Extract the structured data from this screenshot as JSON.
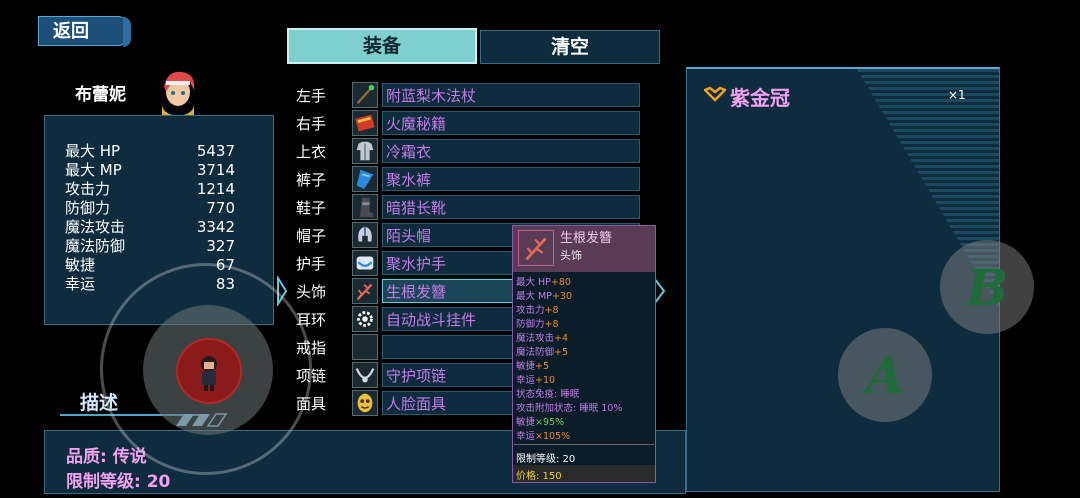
{
  "back_label": "返回",
  "character": {
    "name": "布蕾妮",
    "stats": [
      {
        "label": "最大 HP",
        "value": "5437"
      },
      {
        "label": "最大 MP",
        "value": "3714"
      },
      {
        "label": "攻击力",
        "value": "1214"
      },
      {
        "label": "防御力",
        "value": "770"
      },
      {
        "label": "魔法攻击",
        "value": "3342"
      },
      {
        "label": "魔法防御",
        "value": "327"
      },
      {
        "label": "敏捷",
        "value": "67"
      },
      {
        "label": "幸运",
        "value": "83"
      }
    ]
  },
  "tabs": {
    "equip": "装备",
    "clear": "清空"
  },
  "slots": [
    {
      "slot": "左手",
      "item": "附蓝梨木法杖",
      "icon": "staff-icon"
    },
    {
      "slot": "右手",
      "item": "火魔秘籍",
      "icon": "book-icon"
    },
    {
      "slot": "上衣",
      "item": "冷霜衣",
      "icon": "armor-icon"
    },
    {
      "slot": "裤子",
      "item": "聚水裤",
      "icon": "pants-icon"
    },
    {
      "slot": "鞋子",
      "item": "暗猎长靴",
      "icon": "boots-icon"
    },
    {
      "slot": "帽子",
      "item": "陌头帽",
      "icon": "helmet-icon"
    },
    {
      "slot": "护手",
      "item": "聚水护手",
      "icon": "gauntlet-icon"
    },
    {
      "slot": "头饰",
      "item": "生根发簪",
      "icon": "hairpin-icon"
    },
    {
      "slot": "耳环",
      "item": "自动战斗挂件",
      "icon": "gear-icon"
    },
    {
      "slot": "戒指",
      "item": "",
      "icon": ""
    },
    {
      "slot": "项链",
      "item": "守护项链",
      "icon": "necklace-icon"
    },
    {
      "slot": "面具",
      "item": "人脸面具",
      "icon": "mask-icon"
    }
  ],
  "selected_slot_index": 7,
  "tooltip": {
    "name": "生根发簪",
    "type": "头饰",
    "lines": [
      {
        "label": "最大 HP",
        "value": "+80"
      },
      {
        "label": "最大 MP",
        "value": "+30"
      },
      {
        "label": "攻击力",
        "value": "+8"
      },
      {
        "label": "防御力",
        "value": "+8"
      },
      {
        "label": "魔法攻击",
        "value": "+4"
      },
      {
        "label": "魔法防御",
        "value": "+5"
      },
      {
        "label": "敏捷",
        "value": "+5"
      },
      {
        "label": "幸运",
        "value": "+10"
      },
      {
        "label": "状态免疫: 睡眠",
        "value": ""
      },
      {
        "label": "攻击附加状态: 睡眠 10%",
        "value": ""
      },
      {
        "label": "敏捷",
        "value": "×95%"
      },
      {
        "label": "幸运",
        "value": "×105%"
      }
    ],
    "level_req": "限制等级: 20",
    "price": "价格: 150"
  },
  "description": {
    "label": "描述",
    "quality": "品质: 传说",
    "level_req": "限制等级: 20"
  },
  "detail": {
    "item_name": "紫金冠",
    "quantity": "×1"
  },
  "buttons": {
    "a": "A",
    "b": "B"
  },
  "colors": {
    "panel_bg": "#0e2c3d",
    "item_purple": "#c47be8",
    "stat_bonus_orange": "#f08a30",
    "tab_active": "#7fcfcf",
    "legend_pink": "#f2a0f0"
  }
}
